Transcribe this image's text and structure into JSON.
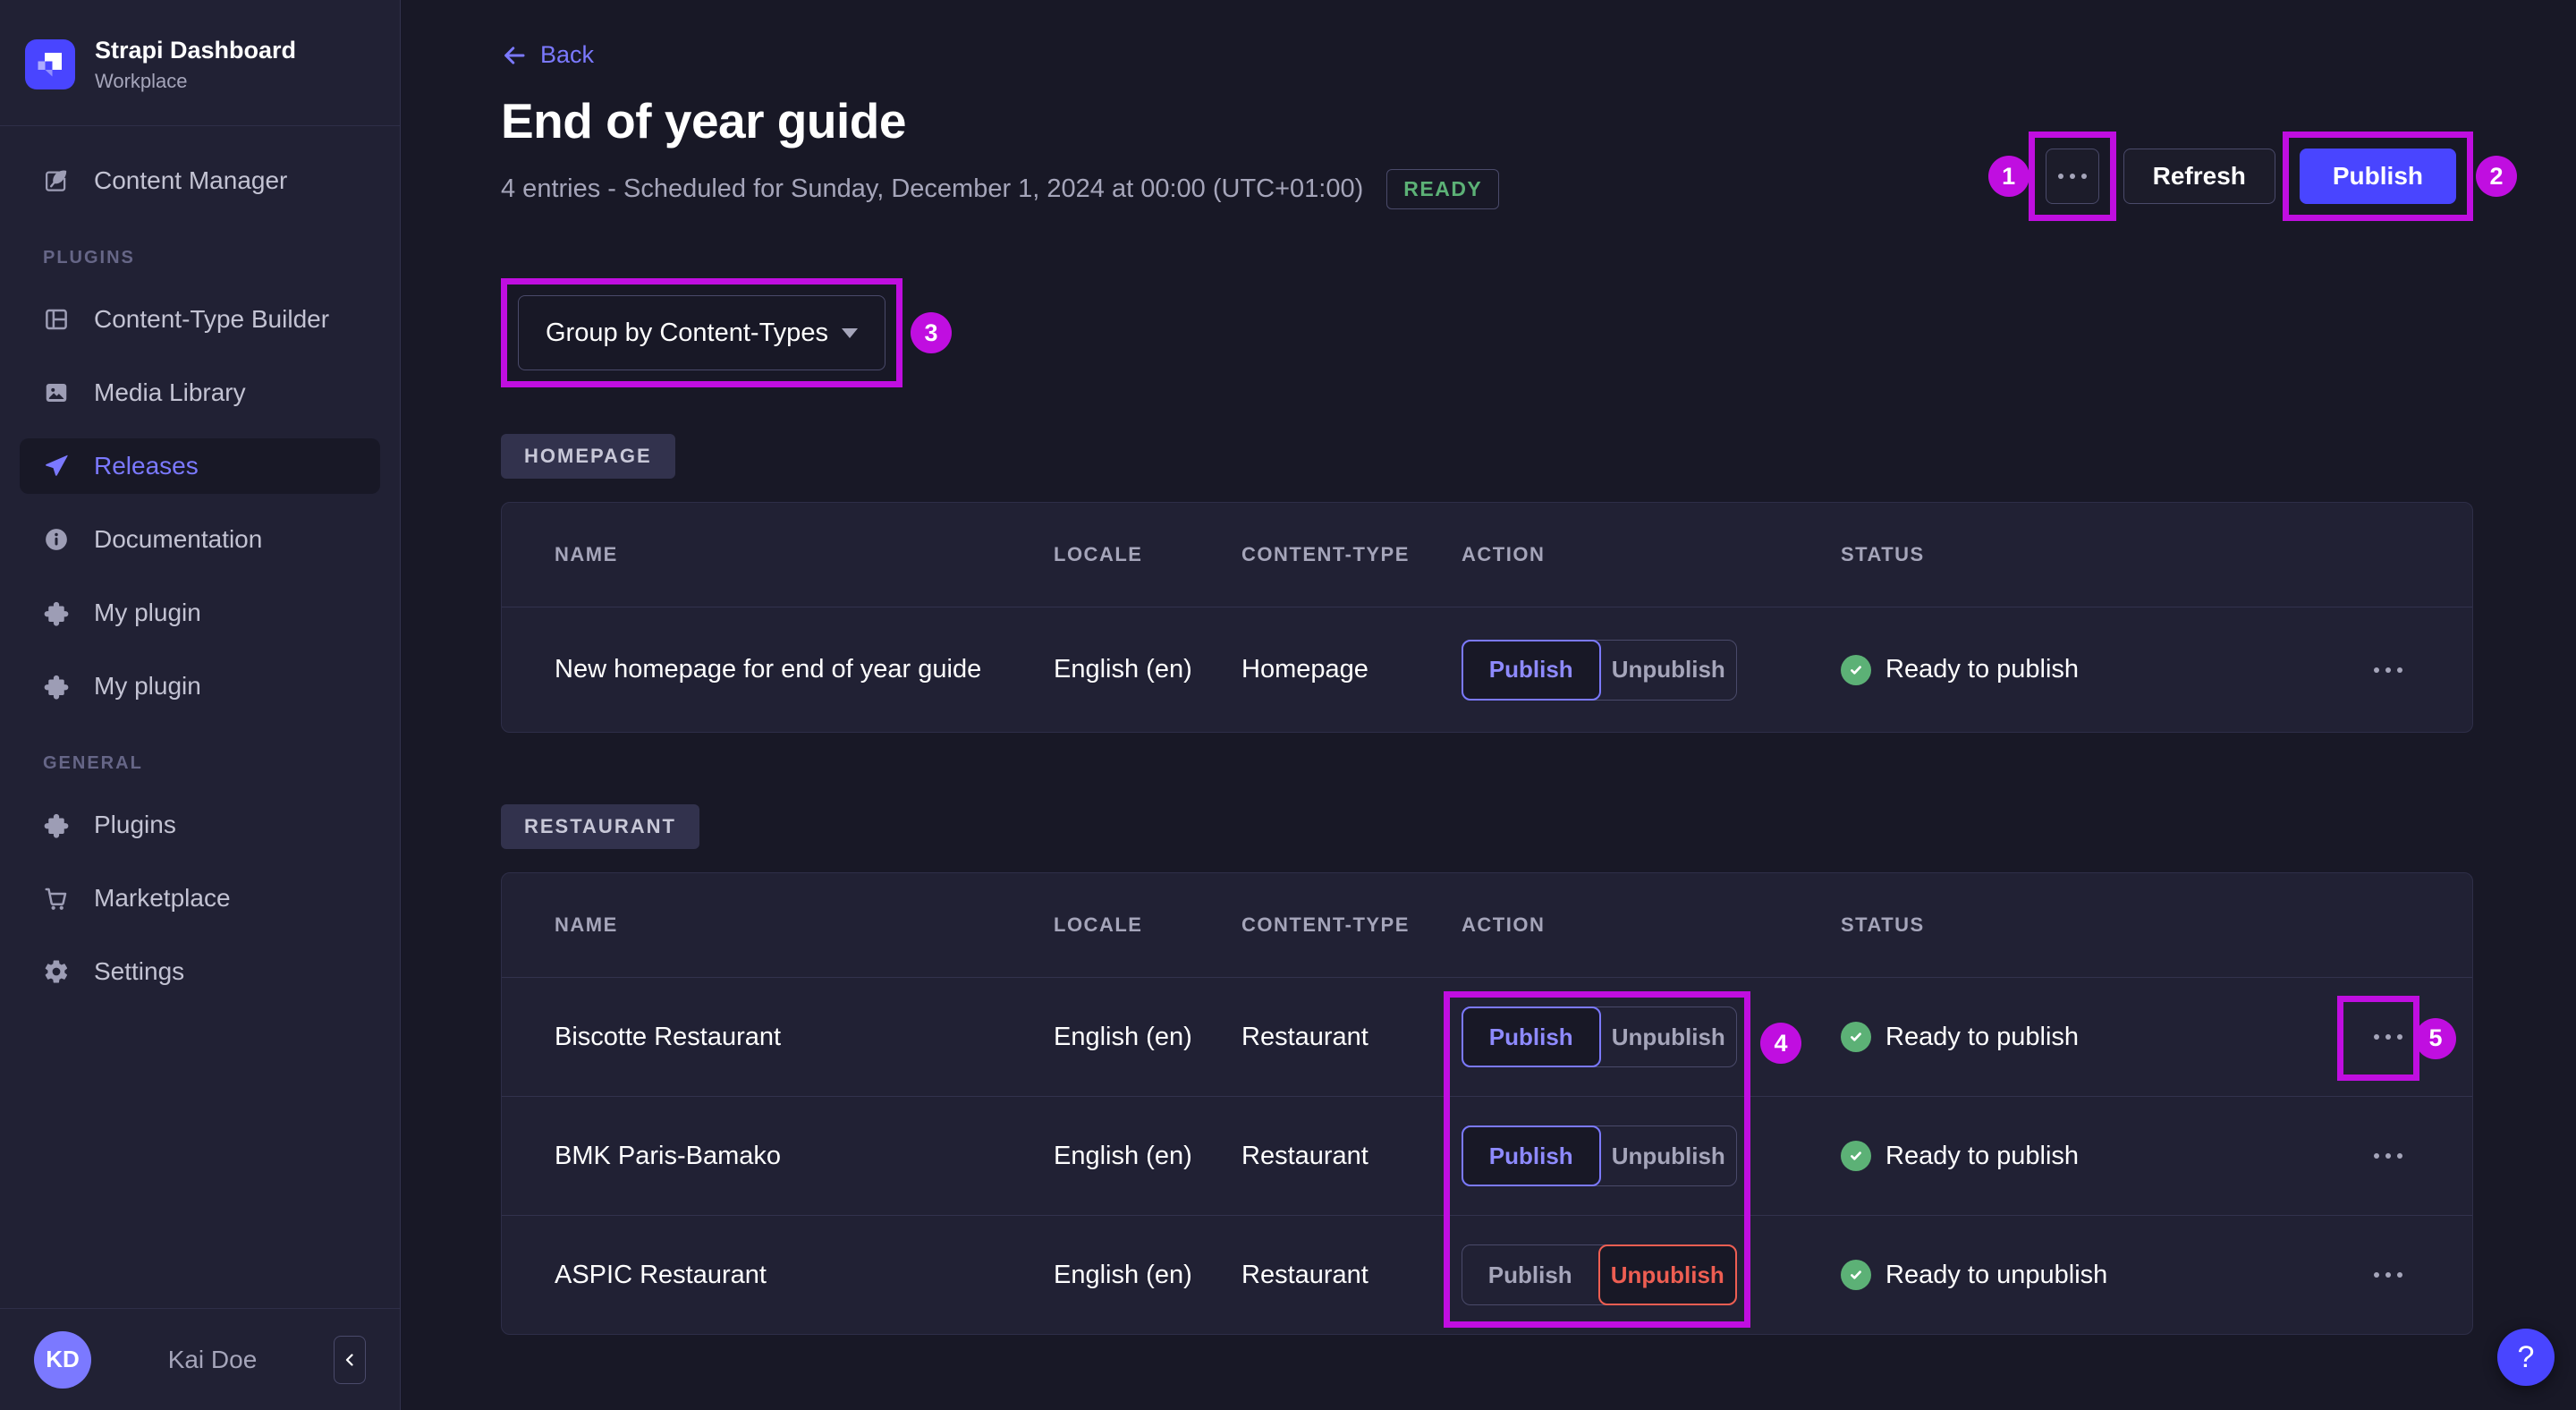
{
  "sidebar": {
    "brand": {
      "title": "Strapi Dashboard",
      "subtitle": "Workplace"
    },
    "top_item": {
      "label": "Content Manager",
      "icon": "pen-icon"
    },
    "sections": [
      {
        "label": "PLUGINS",
        "items": [
          {
            "label": "Content-Type Builder",
            "icon": "layout-icon"
          },
          {
            "label": "Media Library",
            "icon": "image-icon"
          },
          {
            "label": "Releases",
            "icon": "paper-plane-icon",
            "active": true
          },
          {
            "label": "Documentation",
            "icon": "info-icon"
          },
          {
            "label": "My plugin",
            "icon": "puzzle-icon"
          },
          {
            "label": "My plugin",
            "icon": "puzzle-icon"
          }
        ]
      },
      {
        "label": "GENERAL",
        "items": [
          {
            "label": "Plugins",
            "icon": "puzzle-icon"
          },
          {
            "label": "Marketplace",
            "icon": "cart-icon"
          },
          {
            "label": "Settings",
            "icon": "gear-icon"
          }
        ]
      }
    ],
    "user": {
      "initials": "KD",
      "name": "Kai Doe"
    }
  },
  "header": {
    "back_label": "Back",
    "title": "End of year guide",
    "subtitle": "4 entries - Scheduled for Sunday, December 1, 2024 at 00:00 (UTC+01:00)",
    "status_badge": "READY",
    "refresh_label": "Refresh",
    "publish_label": "Publish"
  },
  "toolbar": {
    "group_by_label": "Group by Content-Types"
  },
  "actions": {
    "publish": "Publish",
    "unpublish": "Unpublish"
  },
  "annotations": {
    "color": "#C00EE0",
    "labels": [
      "1",
      "2",
      "3",
      "4",
      "5"
    ]
  },
  "tables": [
    {
      "tag": "HOMEPAGE",
      "columns": [
        "NAME",
        "LOCALE",
        "CONTENT-TYPE",
        "ACTION",
        "STATUS"
      ],
      "rows": [
        {
          "name": "New homepage for end of year guide",
          "locale": "English (en)",
          "content_type": "Homepage",
          "selected_action": "publish",
          "status": "Ready to publish"
        }
      ]
    },
    {
      "tag": "RESTAURANT",
      "columns": [
        "NAME",
        "LOCALE",
        "CONTENT-TYPE",
        "ACTION",
        "STATUS"
      ],
      "rows": [
        {
          "name": "Biscotte Restaurant",
          "locale": "English (en)",
          "content_type": "Restaurant",
          "selected_action": "publish",
          "status": "Ready to publish"
        },
        {
          "name": "BMK Paris-Bamako",
          "locale": "English (en)",
          "content_type": "Restaurant",
          "selected_action": "publish",
          "status": "Ready to publish"
        },
        {
          "name": "ASPIC Restaurant",
          "locale": "English (en)",
          "content_type": "Restaurant",
          "selected_action": "unpublish",
          "status": "Ready to unpublish"
        }
      ]
    }
  ],
  "colors": {
    "accent": "#4945FF",
    "accent_light": "#7B79FF",
    "success": "#5CB176",
    "danger": "#EE5E52"
  },
  "help": {
    "label": "?"
  }
}
